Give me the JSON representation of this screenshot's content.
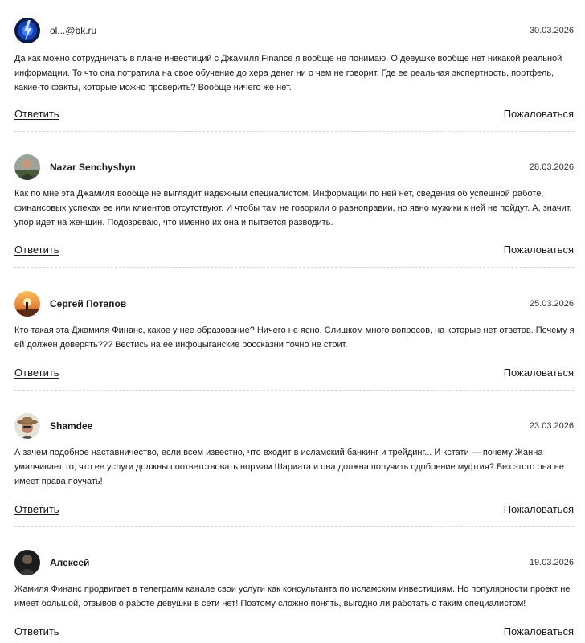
{
  "actions": {
    "reply_label": "Ответить",
    "report_label": "Пожаловаться"
  },
  "comments": [
    {
      "author": "ol...@bk.ru",
      "date": "30.03.2026",
      "text": "Да как можно сотрудничать в плане инвестиций с Джамиля Finance я вообще не понимаю. О девушке вообще нет никакой реальной информации. То что она потратила на свое обучение до хера денег ни о чем не говорит. Где ее реальная экспертность, портфель, какие-то факты, которые можно проверить? Вообще ничего же нет.",
      "avatar_icon": "blue-lightning-avatar-icon"
    },
    {
      "author": "Nazar Senchyshyn",
      "date": "28.03.2026",
      "text": "Как по мне эта Джамиля вообще не выглядит надежным специалистом. Информации по ней нет, сведения об успешной работе, финансовых успехах ее или клиентов отсутствуют. И чтобы там не говорили о равноправии, но явно мужики к ней не пойдут. А, значит, упор идет на женщин. Подозреваю, что именно их она и пытается разводить.",
      "avatar_icon": "user-photo-avatar-icon"
    },
    {
      "author": "Сергей Потапов",
      "date": "25.03.2026",
      "text": "Кто такая эта Джамиля Финанс, какое у нее образование? Ничего не ясно. Слишком много вопросов, на которые нет ответов. Почему я ей должен доверять??? Вестись на ее инфоцыганские россказни точно не стоит.",
      "avatar_icon": "sunset-avatar-icon"
    },
    {
      "author": "Shamdee",
      "date": "23.03.2026",
      "text": "А зачем подобное наставничество, если всем известно, что входит в исламский банкинг и трейдинг... И кстати — почему Жанна умалчивает то, что ее услуги должны соответствовать нормам Шариата и она должна получить одобрение муфтия? Без этого она не имеет права поучать!",
      "avatar_icon": "cowboy-hat-avatar-icon"
    },
    {
      "author": "Алексей",
      "date": "19.03.2026",
      "text": "Жамиля Финанс продвигает в телеграмм канале свои услуги как консультанта по исламским инвестициям. Но популярности проект не имеет большой, отзывов о работе девушки в сети нет! Поэтому сложно понять, выгодно ли работать с таким специалистом!",
      "avatar_icon": "dark-portrait-avatar-icon"
    }
  ]
}
